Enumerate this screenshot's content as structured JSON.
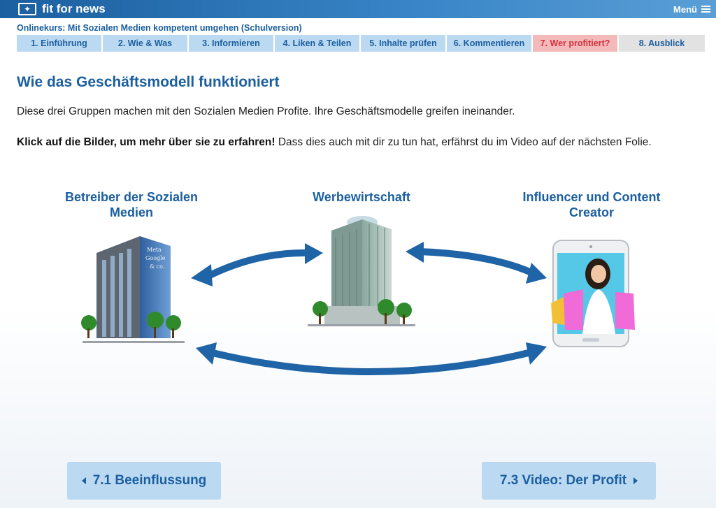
{
  "header": {
    "brand": "fit for news",
    "menu_label": "Menü"
  },
  "course": {
    "title": "Onlinekurs: Mit Sozialen Medien kompetent umgehen (Schulversion)"
  },
  "tabs": [
    {
      "label": "1. Einführung",
      "state": "visited"
    },
    {
      "label": "2. Wie & Was",
      "state": "visited"
    },
    {
      "label": "3. Informieren",
      "state": "visited"
    },
    {
      "label": "4. Liken & Teilen",
      "state": "visited"
    },
    {
      "label": "5. Inhalte prüfen",
      "state": "visited"
    },
    {
      "label": "6. Kommentieren",
      "state": "visited"
    },
    {
      "label": "7. Wer profitiert?",
      "state": "active"
    },
    {
      "label": "8. Ausblick",
      "state": "future"
    }
  ],
  "content": {
    "heading": "Wie das Geschäftsmodell funktioniert",
    "paragraph1": "Diese drei Gruppen machen mit den Sozialen Medien Profite. Ihre Geschäftsmodelle greifen ineinander.",
    "paragraph2_bold": "Klick auf die Bilder, um mehr über sie zu erfahren!",
    "paragraph2_rest": " Dass dies auch mit dir zu tun hat, erfährst du im Video auf der nächsten Folie."
  },
  "groups": {
    "operators": {
      "title": "Betreiber der Sozialen Medien",
      "building_text": [
        "Meta",
        "Google",
        "& co."
      ]
    },
    "advertising": {
      "title": "Werbewirtschaft"
    },
    "influencers": {
      "title": "Influencer und Content Creator"
    }
  },
  "navigation": {
    "prev_label": "7.1 Beeinflussung",
    "next_label": "7.3 Video: Der Profit"
  },
  "colors": {
    "brand_blue": "#1b5fa0",
    "tab_bg": "#bcd9f2",
    "tab_active_bg": "#f4b9b9",
    "tab_active_text": "#d0343f",
    "tab_future_bg": "#e2e2e2",
    "arrow_blue": "#1f64a6"
  }
}
